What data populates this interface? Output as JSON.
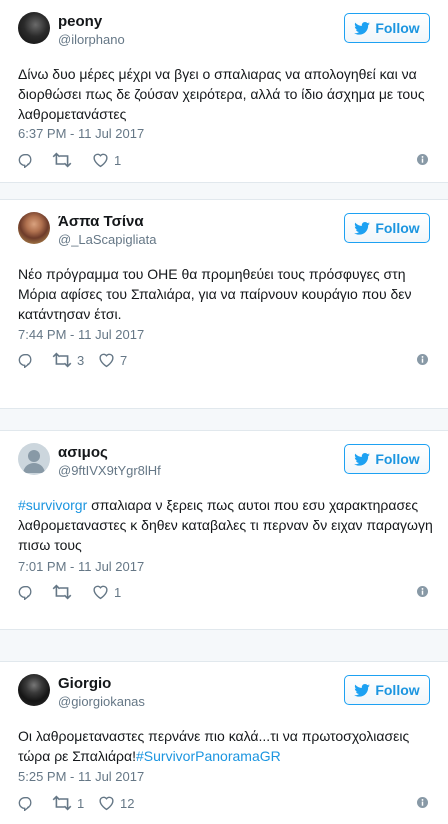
{
  "follow_label": "Follow",
  "accent": "#1da1f2",
  "tweets": [
    {
      "name": "peony",
      "handle": "@ilorphano",
      "text": "Δίνω δυο μέρες μέχρι να βγει ο σπαλιαρας να απολογηθεί και να διορθώσει πως δε ζούσαν χειρότερα, αλλά το ίδιο άσχημα με τους λαθρομετανάστες",
      "time": "6:37 PM - 11 Jul 2017",
      "retweets": "",
      "likes": "1"
    },
    {
      "name": "Άσπα Τσίνα",
      "handle": "@_LaScapigliata",
      "text": "Νέο πρόγραμμα του ΟΗΕ θα προμηθεύει τους πρόσφυγες στη Μόρια αφίσες του Σπαλιάρα, για να παίρνουν κουράγιο που δεν κατάντησαν έτσι.",
      "time": "7:44 PM - 11 Jul 2017",
      "retweets": "3",
      "likes": "7"
    },
    {
      "name": "ασιμος",
      "handle": "@9ftIVX9tYgr8lHf",
      "hashtag": "#survivorgr",
      "text": " σπαλιαρα ν ξερεις πως αυτοι που εσυ χαρακτηρασες λαθρομεταναστες κ δηθεν καταβαλες τι περναν δν ειχαν παραγωγη πισω τους",
      "time": "7:01 PM - 11 Jul 2017",
      "retweets": "",
      "likes": "1"
    },
    {
      "name": "Giorgio",
      "handle": "@giorgiokanas",
      "text": "Οι λαθρομεταναστες περνάνε πιο καλά...τι να πρωτοσχολιασεις τώρα ρε Σπαλιάρα!",
      "hashtag": "#SurvivorPanoramaGR",
      "time": "5:25 PM - 11 Jul 2017",
      "retweets": "1",
      "likes": "12"
    }
  ]
}
